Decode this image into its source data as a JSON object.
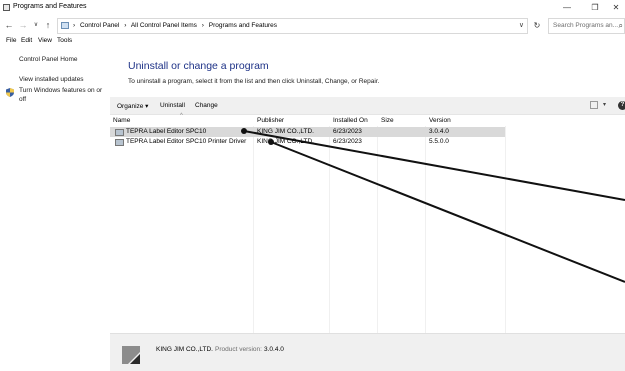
{
  "window": {
    "title": "Programs and Features",
    "minimize": "—",
    "maximize": "❐",
    "close": "✕"
  },
  "nav": {
    "back": "←",
    "forward": "→",
    "recent": "∨",
    "up": "↑",
    "refresh": "↻"
  },
  "address": {
    "crumbs": [
      "›",
      "Control Panel",
      "›",
      "All Control Panel Items",
      "›",
      "Programs and Features"
    ],
    "dropdown": "∨"
  },
  "search": {
    "placeholder": "Search Programs an...",
    "icon": "⌕"
  },
  "menubar": {
    "items": [
      "File",
      "Edit",
      "View",
      "Tools"
    ]
  },
  "leftpane": {
    "home": "Control Panel Home",
    "updates": "View installed updates",
    "features_line1": "Turn Windows features on or",
    "features_line2": "off"
  },
  "main": {
    "heading": "Uninstall or change a program",
    "subtext": "To uninstall a program, select it from the list and then click Uninstall, Change, or Repair."
  },
  "toolbar": {
    "organize": "Organize ▾",
    "uninstall": "Uninstall",
    "change": "Change",
    "view_dropdown": "▾",
    "help": "?"
  },
  "columns": {
    "name": "Name",
    "publisher": "Publisher",
    "installed_on": "Installed On",
    "size": "Size",
    "version": "Version",
    "sort_caret": "^"
  },
  "programs": [
    {
      "name": "TEPRA Label Editor SPC10",
      "publisher": "KING JIM CO.,LTD.",
      "installed_on": "6/23/2023",
      "size": "",
      "version": "3.0.4.0",
      "selected": true
    },
    {
      "name": "TEPRA Label Editor SPC10 Printer Driver",
      "publisher": "KING JIM CO.,LTD.",
      "installed_on": "6/23/2023",
      "size": "",
      "version": "5.5.0.0",
      "selected": false
    }
  ],
  "details": {
    "company": "KING JIM CO.,LTD.",
    "product_version_label": "Product version:",
    "product_version": "3.0.4.0"
  },
  "colors": {
    "heading": "#1e3287",
    "selected_row": "#d9d9d9",
    "toolbar_bg": "#f0f0f0",
    "annotation": "#111111"
  }
}
